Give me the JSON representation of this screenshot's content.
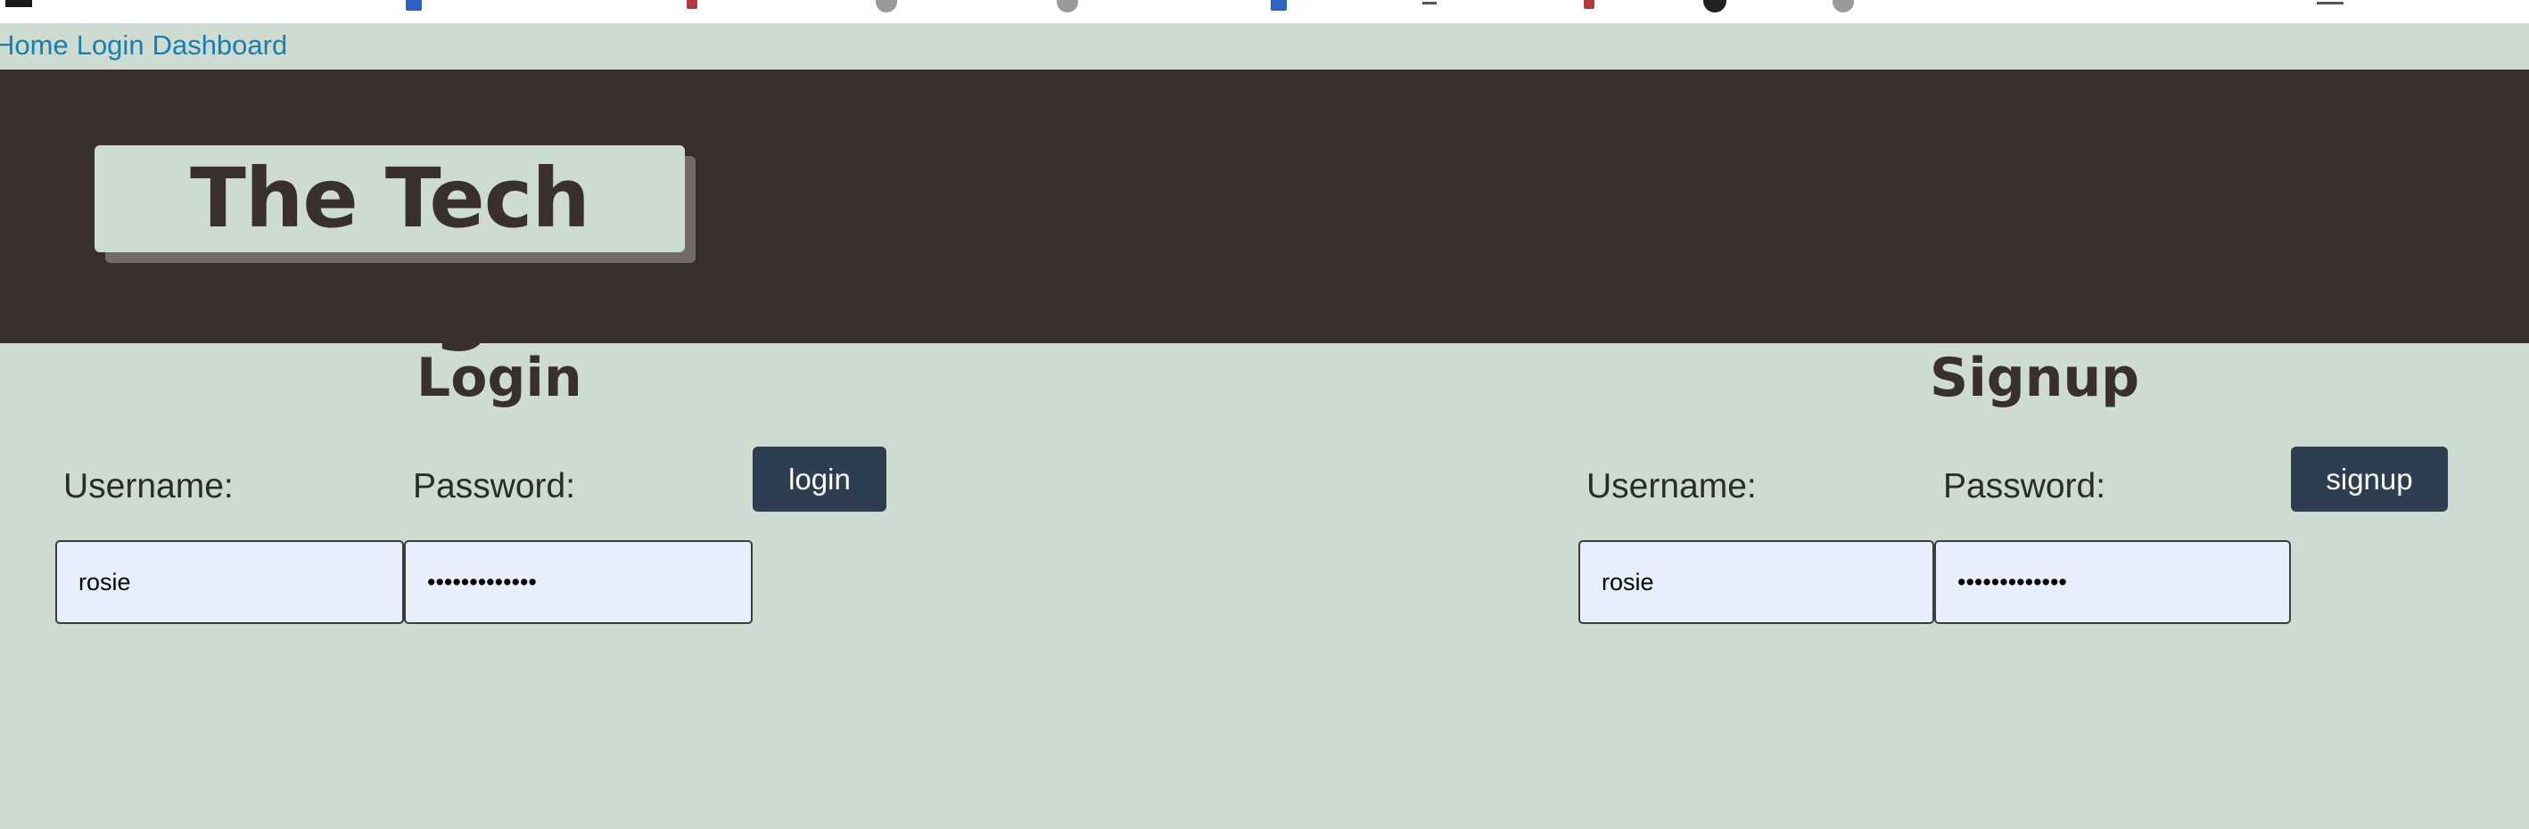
{
  "nav": {
    "links": [
      "Home",
      "Login",
      "Dashboard"
    ]
  },
  "header": {
    "title": "The Tech Blog"
  },
  "login": {
    "title": "Login",
    "username_label": "Username:",
    "password_label": "Password:",
    "username_value": "rosie",
    "password_value": "•••••••••••••",
    "button_label": "login"
  },
  "signup": {
    "title": "Signup",
    "username_label": "Username:",
    "password_label": "Password:",
    "username_value": "rosie",
    "password_value": "•••••••••••••",
    "button_label": "signup"
  },
  "colors": {
    "page_background": "#cddbd1",
    "header_background": "#3a2f2f",
    "button_background": "#2c3e50",
    "link": "#1a7fb0",
    "input_background": "#e8eefb"
  }
}
